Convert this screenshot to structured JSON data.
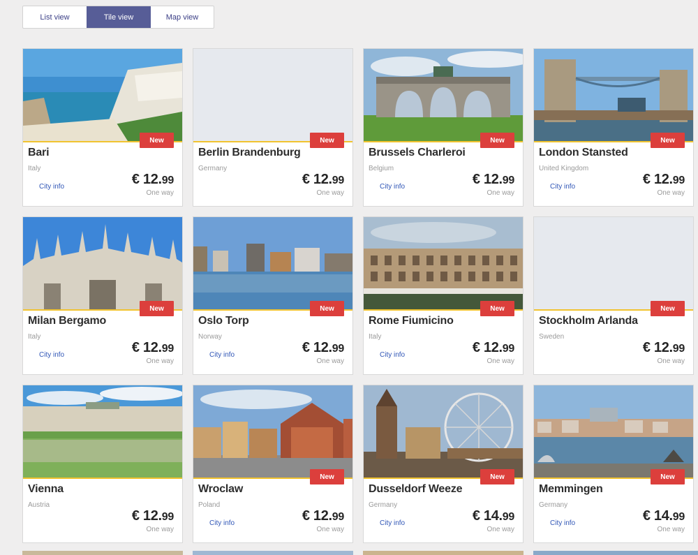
{
  "view_toggle": {
    "list_label": "List view",
    "tile_label": "Tile view",
    "map_label": "Map view",
    "active": "tile"
  },
  "badge_color": "#dc3f3c",
  "accent_color": "#f1c32f",
  "cards": [
    {
      "city": "Bari",
      "country": "Italy",
      "city_info": "City info",
      "price_whole": "€ 12.",
      "price_cents": "99",
      "trip": "One way",
      "new": "New"
    },
    {
      "city": "Berlin Brandenburg",
      "country": "Germany",
      "city_info": "",
      "price_whole": "€ 12.",
      "price_cents": "99",
      "trip": "One way",
      "new": "New"
    },
    {
      "city": "Brussels Charleroi",
      "country": "Belgium",
      "city_info": "City info",
      "price_whole": "€ 12.",
      "price_cents": "99",
      "trip": "One way",
      "new": "New"
    },
    {
      "city": "London Stansted",
      "country": "United Kingdom",
      "city_info": "City info",
      "price_whole": "€ 12.",
      "price_cents": "99",
      "trip": "One way",
      "new": "New"
    },
    {
      "city": "Milan Bergamo",
      "country": "Italy",
      "city_info": "City info",
      "price_whole": "€ 12.",
      "price_cents": "99",
      "trip": "One way",
      "new": "New"
    },
    {
      "city": "Oslo Torp",
      "country": "Norway",
      "city_info": "City info",
      "price_whole": "€ 12.",
      "price_cents": "99",
      "trip": "One way",
      "new": "New"
    },
    {
      "city": "Rome Fiumicino",
      "country": "Italy",
      "city_info": "City info",
      "price_whole": "€ 12.",
      "price_cents": "99",
      "trip": "One way",
      "new": "New"
    },
    {
      "city": "Stockholm Arlanda",
      "country": "Sweden",
      "city_info": "",
      "price_whole": "€ 12.",
      "price_cents": "99",
      "trip": "One way",
      "new": "New"
    },
    {
      "city": "Vienna",
      "country": "Austria",
      "city_info": "",
      "price_whole": "€ 12.",
      "price_cents": "99",
      "trip": "One way",
      "new": ""
    },
    {
      "city": "Wroclaw",
      "country": "Poland",
      "city_info": "City info",
      "price_whole": "€ 12.",
      "price_cents": "99",
      "trip": "One way",
      "new": "New"
    },
    {
      "city": "Dusseldorf Weeze",
      "country": "Germany",
      "city_info": "City info",
      "price_whole": "€ 14.",
      "price_cents": "99",
      "trip": "One way",
      "new": "New"
    },
    {
      "city": "Memmingen",
      "country": "Germany",
      "city_info": "City info",
      "price_whole": "€ 14.",
      "price_cents": "99",
      "trip": "One way",
      "new": "New"
    }
  ]
}
